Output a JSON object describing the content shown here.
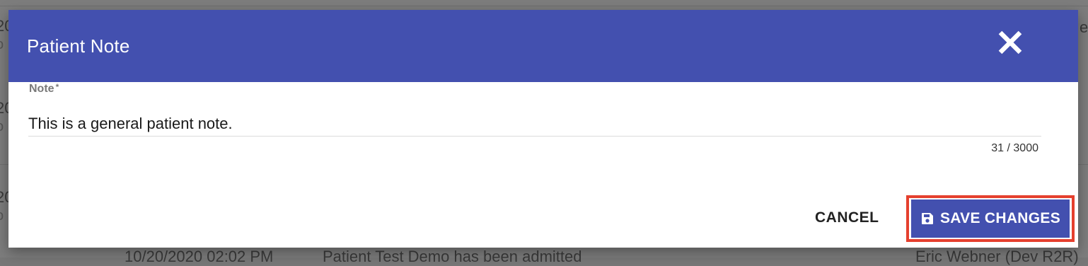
{
  "dialog": {
    "title": "Patient Note",
    "close_icon": "close-icon",
    "field": {
      "label": "Note",
      "required_marker": "*",
      "value": "This is a general patient note.",
      "char_count": "31 / 3000"
    },
    "actions": {
      "cancel_label": "CANCEL",
      "save_label": "SAVE CHANGES",
      "save_icon": "save-icon"
    }
  },
  "background": {
    "row_partial_text": "10/20/2020 02:02 PM",
    "row_message_partial": "Patient Test Demo has been admitted",
    "row_user_partial": "Eric Webner (Dev R2R)"
  },
  "colors": {
    "header": "#4350af",
    "primary_button": "#4350af",
    "highlight_outline": "#e5402e",
    "overlay": "#777777"
  }
}
